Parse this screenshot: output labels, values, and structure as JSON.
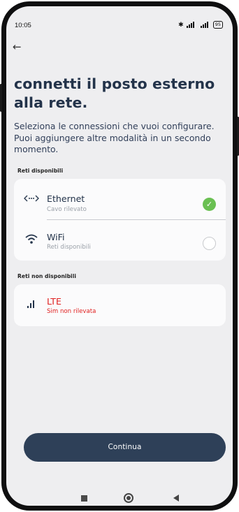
{
  "status_bar": {
    "time": "10:05",
    "indicators": "✱ ∴▎▎▐ ▎▐",
    "battery": "95",
    "icons": [
      "bluetooth-icon",
      "signal-icon",
      "signal-icon",
      "battery-icon"
    ]
  },
  "header": {
    "back_icon": "arrow-left-icon",
    "back_glyph": "←",
    "title": "connetti il posto esterno alla rete.",
    "description": "Seleziona le connessioni che vuoi configurare. Puoi aggiungere altre modalità in un secondo momento."
  },
  "available": {
    "label": "Reti disponibili",
    "items": [
      {
        "icon": "ethernet-icon",
        "glyph": "‹··›",
        "title": "Ethernet",
        "subtitle": "Cavo rilevato",
        "selected": true,
        "check_glyph": "✓"
      },
      {
        "icon": "wifi-icon",
        "glyph": "὏6",
        "title": "WiFi",
        "subtitle": "Reti disponibili",
        "selected": false
      }
    ]
  },
  "unavailable": {
    "label": "Reti non disponibili",
    "items": [
      {
        "icon": "signal-bars-icon",
        "glyph": "▐",
        "title": "LTE",
        "subtitle": "Sim non rilevata"
      }
    ]
  },
  "action": {
    "continue_label": "Continua"
  },
  "colors": {
    "primary": "#2e4058",
    "title": "#23334a",
    "success": "#6ac052",
    "error": "#e02020",
    "background": "#eeeef0",
    "card": "#fbfbfc"
  }
}
